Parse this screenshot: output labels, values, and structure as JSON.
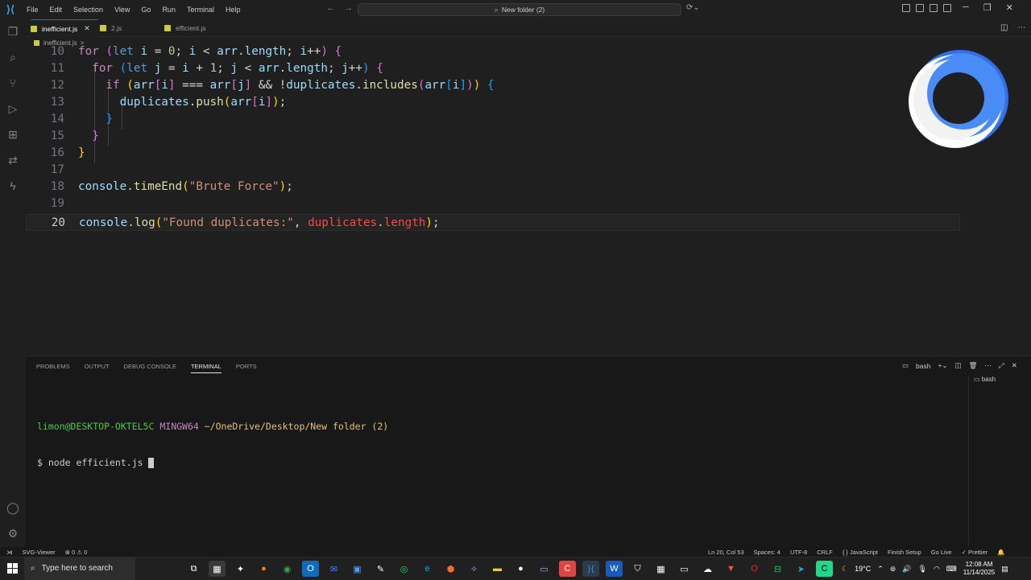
{
  "menu": [
    "File",
    "Edit",
    "Selection",
    "View",
    "Go",
    "Run",
    "Terminal",
    "Help"
  ],
  "command_center": "New folder (2)",
  "tabs": [
    {
      "label": "inefficient.js",
      "active": true
    },
    {
      "label": "2.js",
      "active": false
    },
    {
      "label": "efficient.js",
      "active": false
    }
  ],
  "breadcrumb": {
    "file": "inefficient.js",
    "sep": ">"
  },
  "editor": {
    "line_numbers": [
      "10",
      "11",
      "12",
      "13",
      "14",
      "15",
      "16",
      "17",
      "18",
      "19",
      "20"
    ]
  },
  "panel": {
    "tabs": [
      "PROBLEMS",
      "OUTPUT",
      "DEBUG CONSOLE",
      "TERMINAL",
      "PORTS"
    ],
    "active_tab": "TERMINAL",
    "shell": "bash",
    "prompt_user": "limon@DESKTOP-OKTEL5C",
    "prompt_env": "MINGW64",
    "prompt_path": "~/OneDrive/Desktop/New folder (2)",
    "command": "$ node efficient.js "
  },
  "status": {
    "remote": "SVG-Viewer",
    "errors": "⊗ 0 ⚠ 0",
    "position": "Ln 20, Col 53",
    "spaces": "Spaces: 4",
    "encoding": "UTF-8",
    "eol": "CRLF",
    "language": "{ } JavaScript",
    "finish_setup": "Finish Setup",
    "go_live": "Go Live",
    "prettier": "✓ Prettier"
  },
  "taskbar": {
    "search_placeholder": "Type here to search",
    "weather": "19°C",
    "time": "12:08 AM",
    "date": "11/14/2025"
  },
  "colors": {
    "accent": "#0078d4",
    "editor_bg": "#1f1f1f",
    "panel_bg": "#181818"
  }
}
